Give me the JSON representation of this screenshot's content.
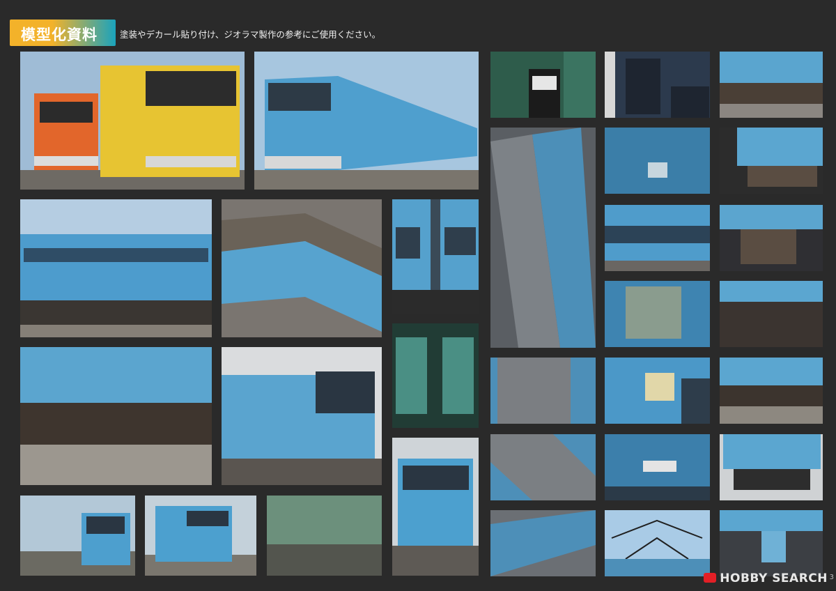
{
  "header": {
    "badge_title": "模型化資料",
    "subtitle": "塗装やデカール貼り付け、ジオラマ製作の参考にご使用ください。"
  },
  "photos": [
    {
      "id": "p1",
      "tone": "sky",
      "kind": "train-front"
    },
    {
      "id": "p2",
      "tone": "sky",
      "kind": "train-side"
    },
    {
      "id": "p3",
      "tone": "green",
      "kind": "cab-detail"
    },
    {
      "id": "p4",
      "tone": "dark",
      "kind": "cab-detail"
    },
    {
      "id": "p5",
      "tone": "blue",
      "kind": "body-detail"
    },
    {
      "id": "p6",
      "tone": "sky",
      "kind": "train-side"
    },
    {
      "id": "p7",
      "tone": "grey",
      "kind": "roof"
    },
    {
      "id": "p8",
      "tone": "blue",
      "kind": "body-detail"
    },
    {
      "id": "p9",
      "tone": "grey",
      "kind": "roof"
    },
    {
      "id": "p10",
      "tone": "blue",
      "kind": "door"
    },
    {
      "id": "p11",
      "tone": "blue",
      "kind": "body-detail"
    },
    {
      "id": "p12",
      "tone": "blue",
      "kind": "window"
    },
    {
      "id": "p13",
      "tone": "blue",
      "kind": "underfloor"
    },
    {
      "id": "p14",
      "tone": "blue",
      "kind": "window"
    },
    {
      "id": "p15",
      "tone": "blue",
      "kind": "underfloor"
    },
    {
      "id": "p16",
      "tone": "blue",
      "kind": "underfloor"
    },
    {
      "id": "p17",
      "tone": "blue",
      "kind": "train-front"
    },
    {
      "id": "p18",
      "tone": "green",
      "kind": "gangway"
    },
    {
      "id": "p19",
      "tone": "grey",
      "kind": "roof"
    },
    {
      "id": "p20",
      "tone": "blue",
      "kind": "number-plate"
    },
    {
      "id": "p21",
      "tone": "blue",
      "kind": "underfloor"
    },
    {
      "id": "p22",
      "tone": "grey",
      "kind": "roof"
    },
    {
      "id": "p23",
      "tone": "blue",
      "kind": "destination"
    },
    {
      "id": "p24",
      "tone": "blue",
      "kind": "coupler"
    },
    {
      "id": "p25",
      "tone": "blue",
      "kind": "train-front"
    },
    {
      "id": "p26",
      "tone": "sky",
      "kind": "train-front"
    },
    {
      "id": "p27",
      "tone": "sky",
      "kind": "train-front"
    },
    {
      "id": "p28",
      "tone": "cream",
      "kind": "body-detail"
    },
    {
      "id": "p29",
      "tone": "grey",
      "kind": "roof"
    },
    {
      "id": "p30",
      "tone": "sky",
      "kind": "pantograph"
    },
    {
      "id": "p31",
      "tone": "blue",
      "kind": "coupler"
    }
  ],
  "watermark": {
    "brand": "HOBBY SEARCH"
  },
  "page_number": "3"
}
